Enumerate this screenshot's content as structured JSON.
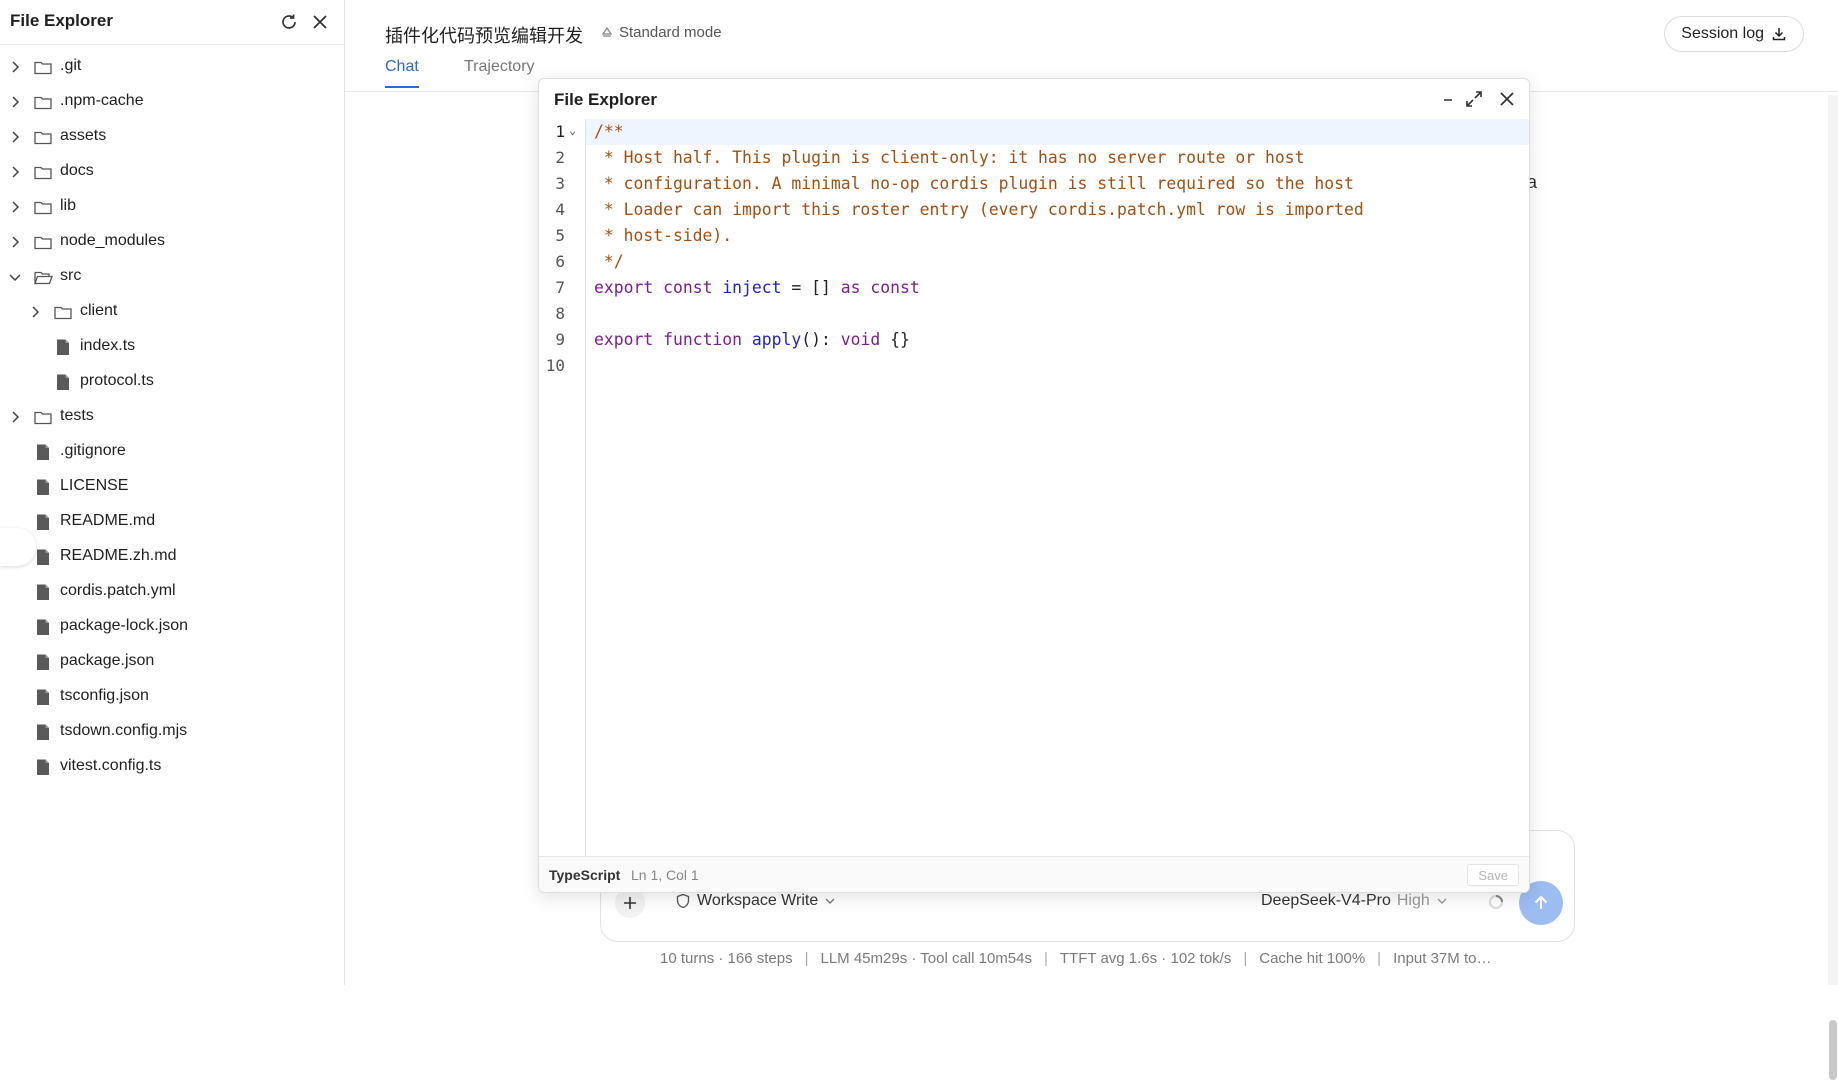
{
  "sidebar": {
    "title": "File Explorer",
    "refresh_icon": "refresh-icon",
    "close_icon": "close-icon",
    "tree": [
      {
        "name": ".git",
        "type": "folder",
        "depth": 0,
        "expanded": false
      },
      {
        "name": ".npm-cache",
        "type": "folder",
        "depth": 0,
        "expanded": false
      },
      {
        "name": "assets",
        "type": "folder",
        "depth": 0,
        "expanded": false
      },
      {
        "name": "docs",
        "type": "folder",
        "depth": 0,
        "expanded": false
      },
      {
        "name": "lib",
        "type": "folder",
        "depth": 0,
        "expanded": false
      },
      {
        "name": "node_modules",
        "type": "folder",
        "depth": 0,
        "expanded": false
      },
      {
        "name": "src",
        "type": "folder",
        "depth": 0,
        "expanded": true
      },
      {
        "name": "client",
        "type": "folder",
        "depth": 1,
        "expanded": false
      },
      {
        "name": "index.ts",
        "type": "file",
        "depth": 1
      },
      {
        "name": "protocol.ts",
        "type": "file",
        "depth": 1
      },
      {
        "name": "tests",
        "type": "folder",
        "depth": 0,
        "expanded": false
      },
      {
        "name": ".gitignore",
        "type": "file",
        "depth": 0
      },
      {
        "name": "LICENSE",
        "type": "file",
        "depth": 0
      },
      {
        "name": "README.md",
        "type": "file",
        "depth": 0
      },
      {
        "name": "README.zh.md",
        "type": "file",
        "depth": 0
      },
      {
        "name": "cordis.patch.yml",
        "type": "file",
        "depth": 0
      },
      {
        "name": "package-lock.json",
        "type": "file",
        "depth": 0
      },
      {
        "name": "package.json",
        "type": "file",
        "depth": 0
      },
      {
        "name": "tsconfig.json",
        "type": "file",
        "depth": 0
      },
      {
        "name": "tsdown.config.mjs",
        "type": "file",
        "depth": 0
      },
      {
        "name": "vitest.config.ts",
        "type": "file",
        "depth": 0
      }
    ]
  },
  "header": {
    "session_title": "插件化代码预览编辑开发",
    "mode_label": "Standard mode",
    "session_log_label": "Session log",
    "tabs": [
      {
        "label": "Chat",
        "active": true
      },
      {
        "label": "Trajectory",
        "active": false
      }
    ]
  },
  "background_text": "a",
  "composer": {
    "permission_label": "Workspace Write",
    "model_label": "DeepSeek-V4-Pro",
    "effort_label": "High"
  },
  "stats": [
    "10 turns · 166 steps",
    "LLM 45m29s · Tool call 10m54s",
    "TTFT avg 1.6s · 102 tok/s",
    "Cache hit 100%",
    "Input 37M to…"
  ],
  "dialog": {
    "title": "File Explorer",
    "language": "TypeScript",
    "cursor_position": "Ln 1, Col 1",
    "save_label": "Save",
    "code_lines": [
      [
        {
          "t": "/**",
          "c": "com"
        }
      ],
      [
        {
          "t": " * Host half. This plugin is client-only: it has no server route or host",
          "c": "com"
        }
      ],
      [
        {
          "t": " * configuration. A minimal no-op cordis plugin is still required so the host",
          "c": "com"
        }
      ],
      [
        {
          "t": " * Loader can import this roster entry (every cordis.patch.yml row is imported",
          "c": "com"
        }
      ],
      [
        {
          "t": " * host-side).",
          "c": "com"
        }
      ],
      [
        {
          "t": " */",
          "c": "com"
        }
      ],
      [
        {
          "t": "export",
          "c": "kw"
        },
        {
          "t": " "
        },
        {
          "t": "const",
          "c": "kw"
        },
        {
          "t": " "
        },
        {
          "t": "inject",
          "c": "id"
        },
        {
          "t": " = [] "
        },
        {
          "t": "as",
          "c": "kw"
        },
        {
          "t": " "
        },
        {
          "t": "const",
          "c": "kw"
        }
      ],
      [],
      [
        {
          "t": "export",
          "c": "kw"
        },
        {
          "t": " "
        },
        {
          "t": "function",
          "c": "kw"
        },
        {
          "t": " "
        },
        {
          "t": "apply",
          "c": "fn"
        },
        {
          "t": "(): "
        },
        {
          "t": "void",
          "c": "kw"
        },
        {
          "t": " {}"
        }
      ],
      []
    ]
  },
  "colors": {
    "accent": "#2a6bd3",
    "send_button": "#9bbdf2",
    "comment": "#a34f12",
    "keyword": "#7a1f8f",
    "identifier": "#1f21c9"
  }
}
